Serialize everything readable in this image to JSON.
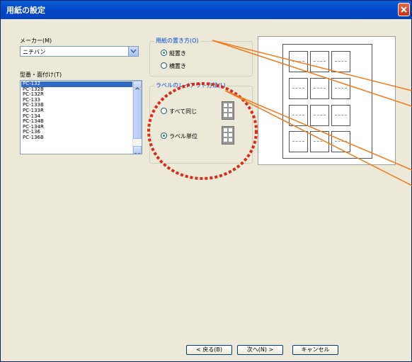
{
  "window": {
    "title": "用紙の設定"
  },
  "maker": {
    "label": "メーカー(M)",
    "value": "ニチバン"
  },
  "model": {
    "label": "型番・面付け(T)",
    "items": [
      "PC-132",
      "PC-132B",
      "PC-132R",
      "PC-133",
      "PC-133B",
      "PC-133R",
      "PC-134",
      "PC-134B",
      "PC-134R",
      "PC-136",
      "PC-136B"
    ],
    "selected_index": 0
  },
  "orientation": {
    "title": "用紙の置き方(O)",
    "options": [
      "縦置き",
      "横置き"
    ],
    "selected_index": 0
  },
  "layout": {
    "title": "ラベルのレイアウト方法(L)",
    "options": [
      "すべて同じ",
      "ラベル単位"
    ],
    "selected_index": 1
  },
  "buttons": {
    "back": "< 戻る(B)",
    "next": "次へ(N) >",
    "cancel": "キャンセル"
  },
  "colors": {
    "annotation_circle": "#dd2a1b",
    "callout_line": "#f07a1b",
    "title_bar": "#0348c8"
  }
}
